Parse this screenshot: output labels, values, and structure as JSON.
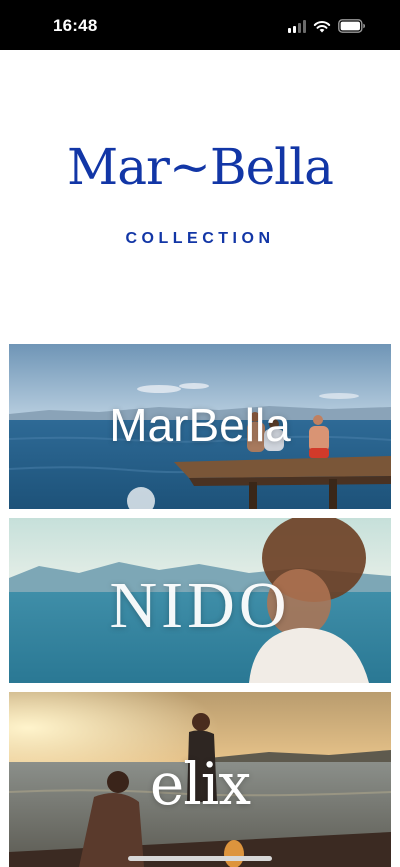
{
  "status_bar": {
    "time": "16:48"
  },
  "logo": {
    "title": "Mar~Bella",
    "subtitle": "COLLECTION"
  },
  "cards": [
    {
      "title": "MarBella"
    },
    {
      "title": "NIDO"
    },
    {
      "title": "elix"
    }
  ],
  "colors": {
    "brand": "#1236a6",
    "status_bar_bg": "#000000"
  }
}
